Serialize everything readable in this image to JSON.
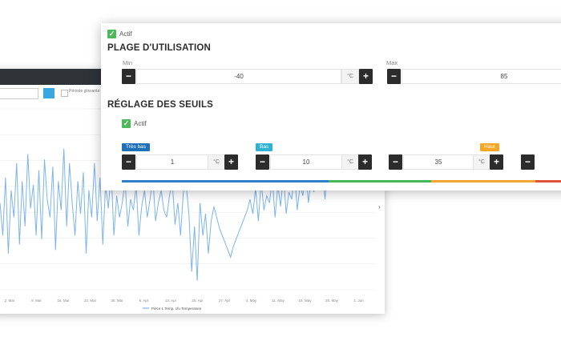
{
  "background_chart": {
    "period_label": "Période glissante",
    "x_ticks": [
      "2. Mar",
      "9. Mar",
      "16. Mar",
      "23. Mar",
      "30. Mar",
      "6. Apr",
      "13. Apr",
      "20. Apr",
      "27. Apr",
      "4. May",
      "11. May",
      "18. May",
      "25. May",
      "1. Jun"
    ],
    "legend": "Pièce 1 Temp. 1fu Temperature",
    "series_color": "#7cb5ec",
    "values": [
      48,
      30,
      62,
      20,
      55,
      40,
      70,
      25,
      60,
      35,
      75,
      45,
      58,
      30,
      66,
      28,
      72,
      50,
      40,
      68,
      22,
      60,
      44,
      78,
      35,
      70,
      48,
      30,
      60,
      42,
      65,
      20,
      55,
      40,
      70,
      38,
      62,
      25,
      58,
      45,
      66,
      30,
      52,
      40,
      48,
      60,
      35,
      50,
      44,
      58,
      30,
      46,
      55,
      40,
      50,
      62,
      38,
      48,
      55,
      44,
      40,
      52,
      60,
      36,
      48,
      30,
      54,
      58,
      42,
      10,
      35,
      5,
      48,
      30,
      42,
      20,
      38,
      46,
      40,
      34,
      30,
      26,
      22,
      18,
      24,
      28,
      32,
      36,
      40,
      44,
      50,
      42,
      56,
      38,
      60,
      44,
      52,
      48,
      62,
      40,
      58,
      46,
      64,
      42,
      54,
      50,
      66,
      44,
      58,
      52,
      68,
      48,
      62,
      54,
      70,
      58,
      66,
      50,
      72,
      60,
      64,
      56,
      70,
      74,
      58,
      68,
      72,
      60,
      76,
      64,
      70,
      66,
      78,
      62,
      72,
      74
    ]
  },
  "panel": {
    "actif_label": "Actif",
    "plage": {
      "title": "PLAGE D'UTILISATION",
      "min_label": "Min",
      "min_value": "-40",
      "min_unit": "°C",
      "max_label": "Max",
      "max_value": "85"
    },
    "seuils": {
      "title": "RÉGLAGE DES SEUILS",
      "actif_label": "Actif",
      "items": [
        {
          "badge": "Très bas",
          "value": "1",
          "unit": "°C",
          "color": "#1f6fb9"
        },
        {
          "badge": "Bas",
          "value": "10",
          "unit": "°C",
          "color": "#2eb3d4"
        },
        {
          "badge": "",
          "value": "35",
          "unit": "°C"
        },
        {
          "badge": "Haut",
          "value": "",
          "unit": "",
          "color": "#f5a623"
        }
      ]
    },
    "bar_colors": [
      "#2f7fc8",
      "#45b85c",
      "#f3a531",
      "#e0533a"
    ]
  }
}
